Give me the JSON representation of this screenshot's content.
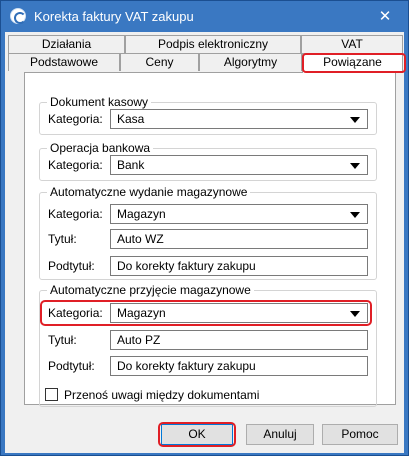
{
  "window": {
    "title": "Korekta faktury VAT zakupu",
    "close_symbol": "✕"
  },
  "tabs": {
    "row1": [
      "Działania",
      "Podpis elektroniczny",
      "VAT"
    ],
    "row2": [
      "Podstawowe",
      "Ceny",
      "Algorytmy",
      "Powiązane"
    ],
    "active": "Powiązane"
  },
  "cash_document": {
    "title": "Dokument kasowy",
    "category_label": "Kategoria:",
    "category_value": "Kasa"
  },
  "bank_operation": {
    "title": "Operacja bankowa",
    "category_label": "Kategoria:",
    "category_value": "Bank"
  },
  "auto_issue": {
    "title": "Automatyczne wydanie magazynowe",
    "category_label": "Kategoria:",
    "category_value": "Magazyn",
    "title_label": "Tytuł:",
    "title_value": "Auto WZ",
    "subtitle_label": "Podtytuł:",
    "subtitle_value": "Do korekty faktury zakupu"
  },
  "auto_receipt": {
    "title": "Automatyczne przyjęcie magazynowe",
    "category_label": "Kategoria:",
    "category_value": "Magazyn",
    "title_label": "Tytuł:",
    "title_value": "Auto PZ",
    "subtitle_label": "Podtytuł:",
    "subtitle_value": "Do korekty faktury zakupu"
  },
  "transfer_notes": {
    "label": "Przenoś uwagi między dokumentami",
    "checked": false
  },
  "buttons": {
    "ok": "OK",
    "cancel": "Anuluj",
    "help": "Pomoc"
  },
  "colors": {
    "title_bar": "#3a78c2",
    "highlight": "#e01f26",
    "focus_border": "#0078d7"
  }
}
